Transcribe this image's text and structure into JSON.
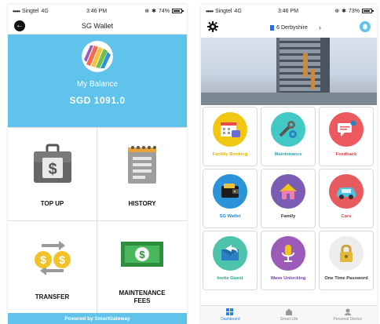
{
  "left": {
    "status": {
      "carrier": "Singtel",
      "network": "4G",
      "time": "3:46 PM",
      "battery": "74%",
      "battery_level": 0.74
    },
    "title": "SG Wallet",
    "balance_label": "My Balance",
    "balance_amount": "SGD 1091.0",
    "actions": [
      {
        "label": "TOP UP",
        "icon": "wallet-icon"
      },
      {
        "label": "HISTORY",
        "icon": "notepad-icon"
      },
      {
        "label": "TRANSFER",
        "icon": "transfer-coins-icon"
      },
      {
        "label": "MAINTENANCE\nFEES",
        "icon": "banknote-icon"
      }
    ],
    "footer": "Powered by SmartGateway",
    "accent": "#5fc3ec"
  },
  "right": {
    "status": {
      "carrier": "Singtel",
      "network": "4G",
      "time": "3:46 PM",
      "battery": "73%",
      "battery_level": 0.73
    },
    "location": "6 Derbyshire",
    "tiles": [
      {
        "label": "Facility Booking",
        "color": "#f2c714",
        "label_color": "#e1b400",
        "icon": "calendar-icon"
      },
      {
        "label": "Maintenance",
        "color": "#43c9c5",
        "label_color": "#2b9fb0",
        "icon": "tools-icon"
      },
      {
        "label": "Feedback",
        "color": "#ec5a5f",
        "label_color": "#e0424a",
        "icon": "chat-icon"
      },
      {
        "label": "SG Wallet",
        "color": "#2b93d8",
        "label_color": "#2a86cf",
        "icon": "wallet-icon"
      },
      {
        "label": "Family",
        "color": "#7c5bb3",
        "label_color": "#333333",
        "icon": "house-icon"
      },
      {
        "label": "Cars",
        "color": "#e75b5e",
        "label_color": "#e0424a",
        "icon": "car-icon"
      },
      {
        "label": "Invite Guest",
        "color": "#4cc3aa",
        "label_color": "#2a9d85",
        "icon": "invite-icon"
      },
      {
        "label": "Wave Unlocking",
        "color": "#9c5bb8",
        "label_color": "#7a3fa3",
        "icon": "microphone-icon"
      },
      {
        "label": "One Time Password",
        "color": "#ededed",
        "label_color": "#333333",
        "icon": "padlock-icon"
      }
    ],
    "tabs": [
      {
        "label": "Dashboard",
        "icon": "dashboard-icon",
        "active": true
      },
      {
        "label": "Smart Life",
        "icon": "home-icon",
        "active": false
      },
      {
        "label": "Personal Device",
        "icon": "device-icon",
        "active": false
      }
    ]
  }
}
